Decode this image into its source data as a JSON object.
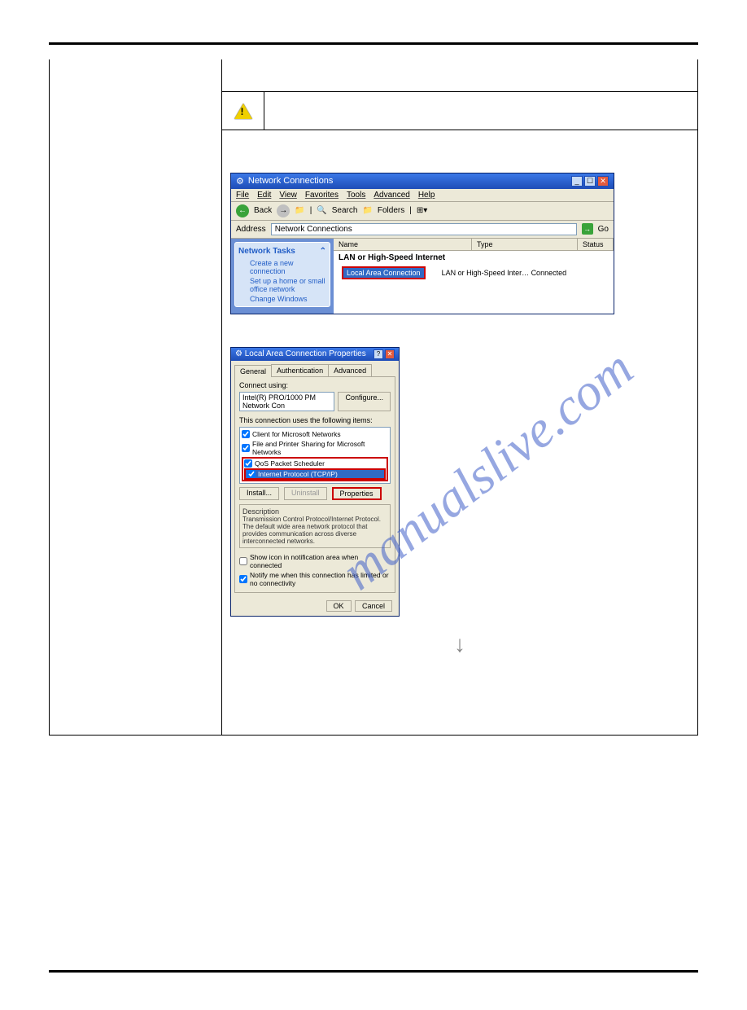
{
  "xp1": {
    "title": "Network Connections",
    "menu": [
      "File",
      "Edit",
      "View",
      "Favorites",
      "Tools",
      "Advanced",
      "Help"
    ],
    "back": "Back",
    "search": "Search",
    "folders": "Folders",
    "addr_label": "Address",
    "addr_value": "Network Connections",
    "go": "Go",
    "side_header": "Network Tasks",
    "side_links": [
      "Create a new connection",
      "Set up a home or small office network",
      "Change Windows"
    ],
    "cols": {
      "name": "Name",
      "type": "Type",
      "status": "Status"
    },
    "group": "LAN or High-Speed Internet",
    "item": "Local Area Connection",
    "item_type": "LAN or High-Speed Inter…",
    "item_status": "Connected"
  },
  "dlg": {
    "title": "Local Area Connection Properties",
    "tabs": [
      "General",
      "Authentication",
      "Advanced"
    ],
    "connect_using_label": "Connect using:",
    "adapter": "Intel(R) PRO/1000 PM Network Con",
    "configure": "Configure...",
    "items_label": "This connection uses the following items:",
    "items": [
      "Client for Microsoft Networks",
      "File and Printer Sharing for Microsoft Networks",
      "QoS Packet Scheduler",
      "Internet Protocol (TCP/IP)"
    ],
    "btn_install": "Install...",
    "btn_uninstall": "Uninstall",
    "btn_properties": "Properties",
    "desc_label": "Description",
    "desc_text": "Transmission Control Protocol/Internet Protocol. The default wide area network protocol that provides communication across diverse interconnected networks.",
    "ck1": "Show icon in notification area when connected",
    "ck2": "Notify me when this connection has limited or no connectivity",
    "ok": "OK",
    "cancel": "Cancel"
  },
  "watermark": "manualslive.com",
  "arrow": "↓"
}
